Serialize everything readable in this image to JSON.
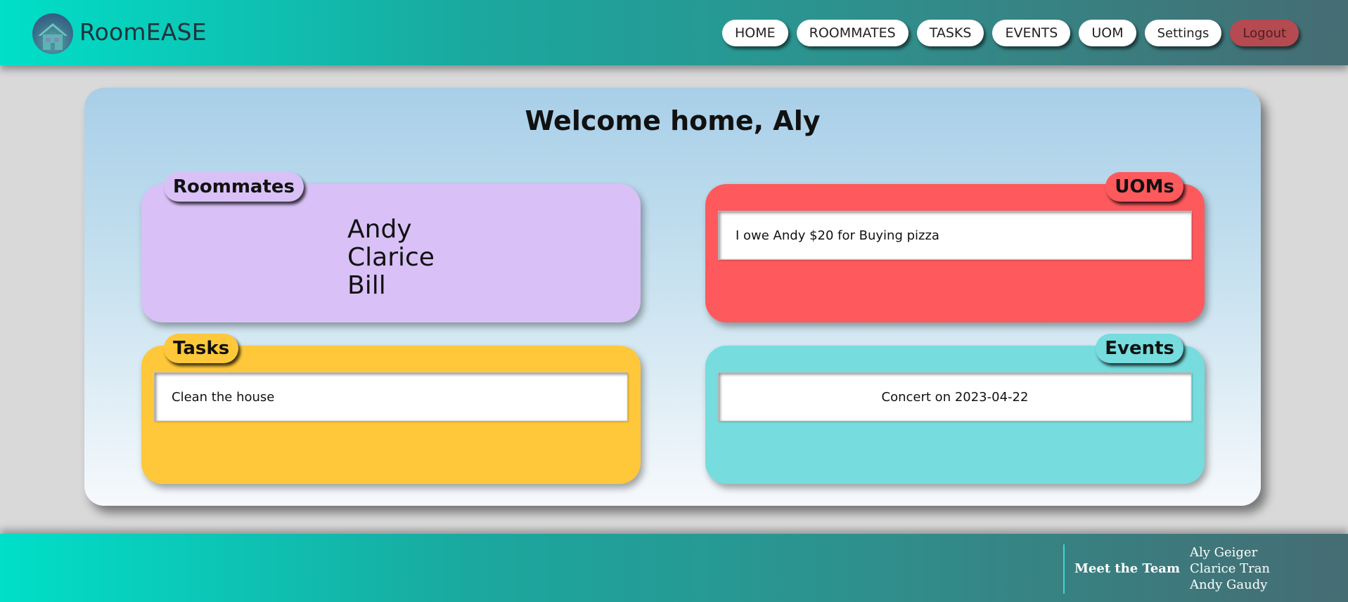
{
  "header": {
    "brand": "RoomEASE",
    "nav": [
      {
        "label": "HOME"
      },
      {
        "label": "ROOMMATES"
      },
      {
        "label": "TASKS"
      },
      {
        "label": "EVENTS"
      },
      {
        "label": "UOM"
      },
      {
        "label": "Settings"
      },
      {
        "label": "Logout"
      }
    ]
  },
  "main": {
    "welcome": "Welcome home, Aly",
    "roommates": {
      "title": "Roommates",
      "names": [
        "Andy",
        "Clarice",
        "Bill"
      ]
    },
    "uoms": {
      "title": "UOMs",
      "items": [
        "I owe Andy $20 for Buying pizza"
      ]
    },
    "tasks": {
      "title": "Tasks",
      "items": [
        "Clean the house"
      ]
    },
    "events": {
      "title": "Events",
      "items": [
        "Concert on 2023-04-22"
      ]
    }
  },
  "footer": {
    "meet_label": "Meet the Team",
    "team": [
      "Aly Geiger",
      "Clarice Tran",
      "Andy Gaudy"
    ]
  },
  "colors": {
    "roommates_panel": "#d9c1f7",
    "uoms_panel": "#fe5a5e",
    "tasks_panel": "#ffc83a",
    "events_panel": "#76dcdd",
    "logout": "#b54a50"
  },
  "icons": {
    "logo": "house-logo-icon"
  }
}
